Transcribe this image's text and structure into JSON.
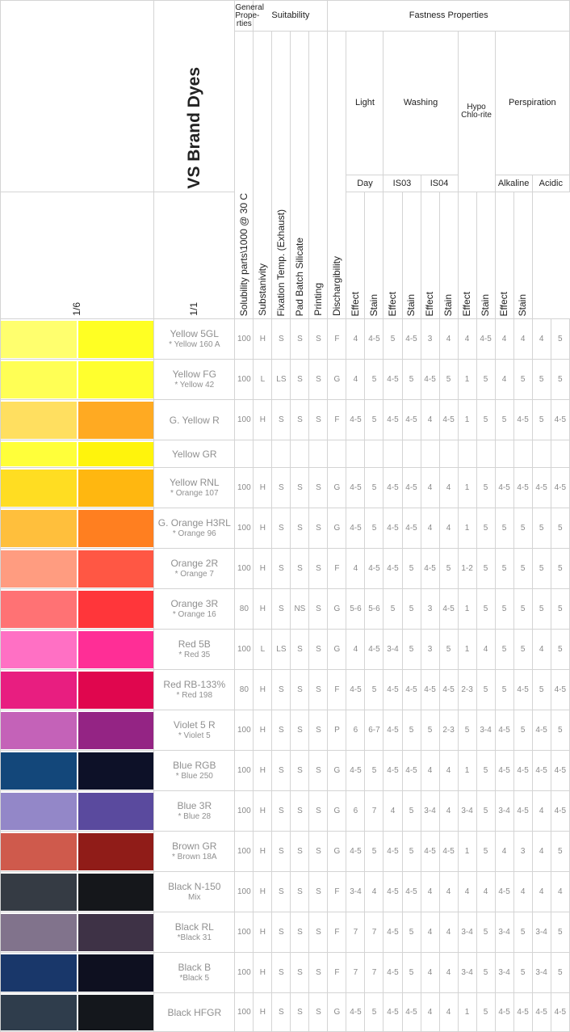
{
  "header": {
    "brand_title": "VS Brand Dyes",
    "group_general": "General Prope-rties",
    "group_suitability": "Suitability",
    "group_fastness": "Fastness Properties",
    "sub_light": "Light",
    "sub_washing": "Washing",
    "sub_hypo": "Hypo Chlo-rite",
    "sub_perspiration": "Perspiration",
    "sub_day": "Day",
    "sub_iso3": "IS03",
    "sub_iso4": "IS04",
    "sub_alkaline": "Alkaline",
    "sub_acidic": "Acidic",
    "columns": [
      "Solubility parts\\1000 @ 30 C",
      "Substanivity",
      "Fixation Temp. (Exhaust)",
      "Pad Batch Silicate",
      "Printing",
      "Dischargibility",
      "1/6",
      "1/1",
      "Effect",
      "Stain",
      "Effect",
      "Stain",
      "Effect",
      "Stain",
      "Effect",
      "Stain",
      "Effect",
      "Stain"
    ]
  },
  "rows": [
    {
      "name": "Yellow 5GL",
      "sub": "* Yellow 160 A",
      "c1": "#ffff6e",
      "c2": "#ffff23",
      "v": [
        "100",
        "H",
        "S",
        "S",
        "S",
        "F",
        "4",
        "4-5",
        "5",
        "4-5",
        "3",
        "4",
        "4",
        "4-5",
        "4",
        "4",
        "4",
        "5"
      ]
    },
    {
      "name": "Yellow FG",
      "sub": "* Yellow 42",
      "c1": "#ffff55",
      "c2": "#ffff2e",
      "v": [
        "100",
        "L",
        "LS",
        "S",
        "S",
        "G",
        "4",
        "5",
        "4-5",
        "5",
        "4-5",
        "5",
        "1",
        "5",
        "4",
        "5",
        "5",
        "5"
      ]
    },
    {
      "name": "G. Yellow R",
      "sub": "",
      "c1": "#ffdf60",
      "c2": "#ffaa22",
      "v": [
        "100",
        "H",
        "S",
        "S",
        "S",
        "F",
        "4-5",
        "5",
        "4-5",
        "4-5",
        "4",
        "4-5",
        "1",
        "5",
        "5",
        "4-5",
        "5",
        "4-5"
      ]
    },
    {
      "name": "Yellow GR",
      "sub": "",
      "c1": "#ffff3a",
      "c2": "#fff40c",
      "v": [
        "",
        "",
        "",
        "",
        "",
        "",
        "",
        "",
        "",
        "",
        "",
        "",
        "",
        "",
        "",
        "",
        "",
        ""
      ]
    },
    {
      "name": "Yellow RNL",
      "sub": "* Orange 107",
      "c1": "#ffdd22",
      "c2": "#ffb710",
      "v": [
        "100",
        "H",
        "S",
        "S",
        "S",
        "G",
        "4-5",
        "5",
        "4-5",
        "4-5",
        "4",
        "4",
        "1",
        "5",
        "4-5",
        "4-5",
        "4-5",
        "4-5"
      ]
    },
    {
      "name": "G. Orange H3RL",
      "sub": "* Orange 96",
      "c1": "#ffbf3c",
      "c2": "#ff7f20",
      "v": [
        "100",
        "H",
        "S",
        "S",
        "S",
        "G",
        "4-5",
        "5",
        "4-5",
        "4-5",
        "4",
        "4",
        "1",
        "5",
        "5",
        "5",
        "5",
        "5"
      ]
    },
    {
      "name": "Orange 2R",
      "sub": "* Orange 7",
      "c1": "#ff9c80",
      "c2": "#ff5744",
      "v": [
        "100",
        "H",
        "S",
        "S",
        "S",
        "F",
        "4",
        "4-5",
        "4-5",
        "5",
        "4-5",
        "5",
        "1-2",
        "5",
        "5",
        "5",
        "5",
        "5"
      ]
    },
    {
      "name": "Orange 3R",
      "sub": "* Orange 16",
      "c1": "#ff7274",
      "c2": "#ff363a",
      "v": [
        "80",
        "H",
        "S",
        "NS",
        "S",
        "G",
        "5-6",
        "5-6",
        "5",
        "5",
        "3",
        "4-5",
        "1",
        "5",
        "5",
        "5",
        "5",
        "5"
      ]
    },
    {
      "name": "Red 5B",
      "sub": "* Red 35",
      "c1": "#ff70c4",
      "c2": "#ff2e96",
      "v": [
        "100",
        "L",
        "LS",
        "S",
        "S",
        "G",
        "4",
        "4-5",
        "3-4",
        "5",
        "3",
        "5",
        "1",
        "4",
        "5",
        "5",
        "4",
        "5"
      ]
    },
    {
      "name": "Red RB-133%",
      "sub": "* Red 198",
      "c1": "#e81e80",
      "c2": "#e0064e",
      "v": [
        "80",
        "H",
        "S",
        "S",
        "S",
        "F",
        "4-5",
        "5",
        "4-5",
        "4-5",
        "4-5",
        "4-5",
        "2-3",
        "5",
        "5",
        "4-5",
        "5",
        "4-5"
      ]
    },
    {
      "name": "Violet 5 R",
      "sub": "* Violet 5",
      "c1": "#c462b8",
      "c2": "#942484",
      "v": [
        "100",
        "H",
        "S",
        "S",
        "S",
        "P",
        "6",
        "6-7",
        "4-5",
        "5",
        "5",
        "2-3",
        "5",
        "3-4",
        "4-5",
        "5",
        "4-5",
        "5"
      ]
    },
    {
      "name": "Blue RGB",
      "sub": "* Blue 250",
      "c1": "#13477a",
      "c2": "#0d1128",
      "v": [
        "100",
        "H",
        "S",
        "S",
        "S",
        "G",
        "4-5",
        "5",
        "4-5",
        "4-5",
        "4",
        "4",
        "1",
        "5",
        "4-5",
        "4-5",
        "4-5",
        "4-5"
      ]
    },
    {
      "name": "Blue 3R",
      "sub": "* Blue 28",
      "c1": "#9387c8",
      "c2": "#5a4a9e",
      "v": [
        "100",
        "H",
        "S",
        "S",
        "S",
        "G",
        "6",
        "7",
        "4",
        "5",
        "3-4",
        "4",
        "3-4",
        "5",
        "3-4",
        "4-5",
        "4",
        "4-5"
      ]
    },
    {
      "name": "Brown GR",
      "sub": "* Brown 18A",
      "c1": "#cf5a4c",
      "c2": "#901c18",
      "v": [
        "100",
        "H",
        "S",
        "S",
        "S",
        "G",
        "4-5",
        "5",
        "4-5",
        "5",
        "4-5",
        "4-5",
        "1",
        "5",
        "4",
        "3",
        "4",
        "5"
      ]
    },
    {
      "name": "Black N-150",
      "sub": "Mix",
      "c1": "#353b44",
      "c2": "#15171b",
      "v": [
        "100",
        "H",
        "S",
        "S",
        "S",
        "F",
        "3-4",
        "4",
        "4-5",
        "4-5",
        "4",
        "4",
        "4",
        "4",
        "4-5",
        "4",
        "4",
        "4"
      ]
    },
    {
      "name": "Black RL",
      "sub": "*Black 31",
      "c1": "#81738c",
      "c2": "#3e3246",
      "v": [
        "100",
        "H",
        "S",
        "S",
        "S",
        "F",
        "7",
        "7",
        "4-5",
        "5",
        "4",
        "4",
        "3-4",
        "5",
        "3-4",
        "5",
        "3-4",
        "5"
      ]
    },
    {
      "name": "Black B",
      "sub": "*Black 5",
      "c1": "#19376a",
      "c2": "#0e1020",
      "v": [
        "100",
        "H",
        "S",
        "S",
        "S",
        "F",
        "7",
        "7",
        "4-5",
        "5",
        "4",
        "4",
        "3-4",
        "5",
        "3-4",
        "5",
        "3-4",
        "5"
      ]
    },
    {
      "name": "Black HFGR",
      "sub": "",
      "c1": "#2f3d4c",
      "c2": "#14171c",
      "v": [
        "100",
        "H",
        "S",
        "S",
        "S",
        "G",
        "4-5",
        "5",
        "4-5",
        "4-5",
        "4",
        "4",
        "1",
        "5",
        "4-5",
        "4-5",
        "4-5",
        "4-5"
      ]
    }
  ]
}
